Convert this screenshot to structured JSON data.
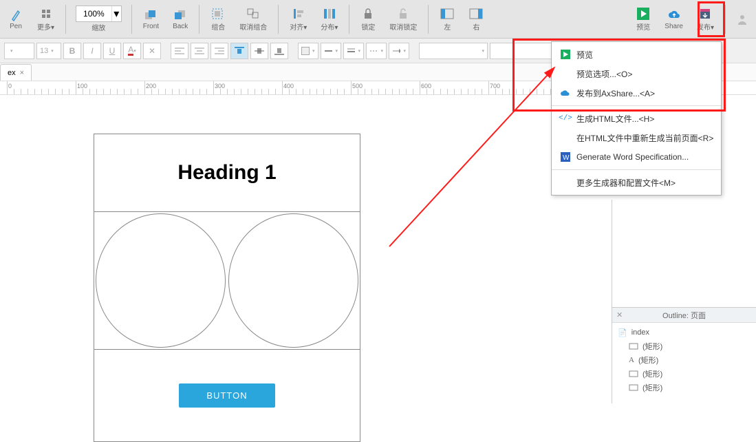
{
  "toolbar": {
    "pen": "Pen",
    "more": "更多▾",
    "zoom_value": "100%",
    "zoom_label": "缩放",
    "front": "Front",
    "back": "Back",
    "group": "组合",
    "ungroup": "取消组合",
    "align": "对齐▾",
    "distribute": "分布▾",
    "lock": "锁定",
    "unlock": "取消锁定",
    "left": "左",
    "right": "右",
    "preview": "预览",
    "share": "Share",
    "publish": "发布▾"
  },
  "format_bar": {
    "font_size": "13"
  },
  "tab": {
    "name": "ex",
    "close": "×"
  },
  "ruler_ticks": [
    0,
    100,
    200,
    300,
    400,
    500,
    600,
    700
  ],
  "canvas": {
    "heading": "Heading 1",
    "button": "BUTTON"
  },
  "menu": {
    "items": [
      {
        "icon": "play",
        "label": "预览"
      },
      {
        "icon": "",
        "label": "预览选项...<O>"
      },
      {
        "icon": "cloud",
        "label": "发布到AxShare...<A>"
      },
      {
        "sep": true
      },
      {
        "icon": "code",
        "label": "生成HTML文件...<H>"
      },
      {
        "icon": "",
        "label": "在HTML文件中重新生成当前页面<R>"
      },
      {
        "icon": "word",
        "label": "Generate Word Specification..."
      },
      {
        "sep": true
      },
      {
        "icon": "",
        "label": "更多生成器和配置文件<M>"
      }
    ]
  },
  "outline": {
    "title": "Outline: 页面",
    "root": "index",
    "items": [
      {
        "icon": "rect",
        "label": "(矩形)"
      },
      {
        "icon": "text",
        "label": "(矩形)"
      },
      {
        "icon": "rect",
        "label": "(矩形)"
      },
      {
        "icon": "rect",
        "label": "(矩形)"
      }
    ]
  }
}
